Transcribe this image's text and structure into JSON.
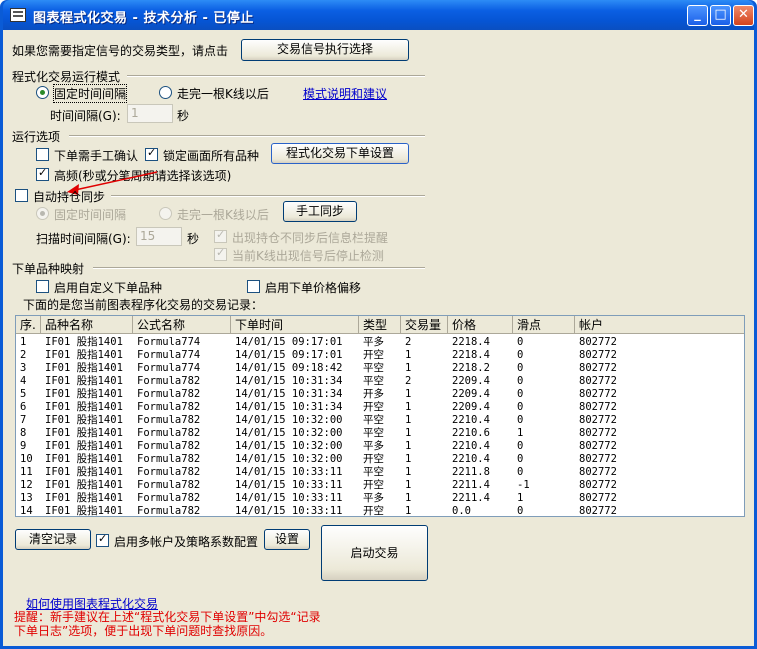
{
  "window": {
    "title": "图表程式化交易 - 技术分析 - 已停止",
    "min": "_",
    "max": "□",
    "close": "✕"
  },
  "signal": {
    "prompt": "如果您需要指定信号的交易类型，请点击",
    "button": "交易信号执行选择"
  },
  "mode": {
    "heading": "程式化交易运行模式",
    "fixed_interval": "固定时间间隔",
    "bar_close": "走完一根K线以后",
    "help_link": "模式说明和建议",
    "interval_label": "时间间隔(G):",
    "interval_value": "1",
    "interval_unit": "秒"
  },
  "run_options": {
    "heading": "运行选项",
    "manual_confirm": "下单需手工确认",
    "lock_symbols": "锁定画面所有品种",
    "order_settings_button": "程式化交易下单设置",
    "high_freq": "高频(秒或分笔周期请选择该选项)"
  },
  "sync": {
    "auto_sync": "自动持仓同步",
    "fixed_interval": "固定时间间隔",
    "bar_close": "走完一根K线以后",
    "manual_sync_button": "手工同步",
    "scan_label": "扫描时间间隔(G):",
    "scan_value": "15",
    "scan_unit": "秒",
    "notify_mismatch": "出现持仓不同步后信息栏提醒",
    "stop_on_signal": "当前K线出现信号后停止检测"
  },
  "mapping": {
    "heading": "下单品种映射",
    "custom_symbol": "启用自定义下单品种",
    "price_offset": "启用下单价格偏移",
    "records_caption": "下面的是您当前图表程序化交易的交易记录："
  },
  "table": {
    "headers": [
      "序.",
      "品种名称",
      "公式名称",
      "下单时间",
      "类型",
      "交易量",
      "价格",
      "滑点",
      "帐户"
    ],
    "rows": [
      [
        "1",
        "IF01 股指1401",
        "Formula774",
        "14/01/15 09:17:01",
        "平多",
        "2",
        "2218.4",
        "0",
        "802772"
      ],
      [
        "2",
        "IF01 股指1401",
        "Formula774",
        "14/01/15 09:17:01",
        "开空",
        "1",
        "2218.4",
        "0",
        "802772"
      ],
      [
        "3",
        "IF01 股指1401",
        "Formula774",
        "14/01/15 09:18:42",
        "平空",
        "1",
        "2218.2",
        "0",
        "802772"
      ],
      [
        "4",
        "IF01 股指1401",
        "Formula782",
        "14/01/15 10:31:34",
        "平空",
        "2",
        "2209.4",
        "0",
        "802772"
      ],
      [
        "5",
        "IF01 股指1401",
        "Formula782",
        "14/01/15 10:31:34",
        "开多",
        "1",
        "2209.4",
        "0",
        "802772"
      ],
      [
        "6",
        "IF01 股指1401",
        "Formula782",
        "14/01/15 10:31:34",
        "开空",
        "1",
        "2209.4",
        "0",
        "802772"
      ],
      [
        "7",
        "IF01 股指1401",
        "Formula782",
        "14/01/15 10:32:00",
        "平空",
        "1",
        "2210.4",
        "0",
        "802772"
      ],
      [
        "8",
        "IF01 股指1401",
        "Formula782",
        "14/01/15 10:32:00",
        "平空",
        "1",
        "2210.6",
        "1",
        "802772"
      ],
      [
        "9",
        "IF01 股指1401",
        "Formula782",
        "14/01/15 10:32:00",
        "平多",
        "1",
        "2210.4",
        "0",
        "802772"
      ],
      [
        "10",
        "IF01 股指1401",
        "Formula782",
        "14/01/15 10:32:00",
        "开空",
        "1",
        "2210.4",
        "0",
        "802772"
      ],
      [
        "11",
        "IF01 股指1401",
        "Formula782",
        "14/01/15 10:33:11",
        "平空",
        "1",
        "2211.8",
        "0",
        "802772"
      ],
      [
        "12",
        "IF01 股指1401",
        "Formula782",
        "14/01/15 10:33:11",
        "开空",
        "1",
        "2211.4",
        "-1",
        "802772"
      ],
      [
        "13",
        "IF01 股指1401",
        "Formula782",
        "14/01/15 10:33:11",
        "平多",
        "1",
        "2211.4",
        "1",
        "802772"
      ],
      [
        "14",
        "IF01 股指1401",
        "Formula782",
        "14/01/15 10:33:11",
        "开空",
        "1",
        "0.0",
        "0",
        "802772"
      ]
    ]
  },
  "footer": {
    "clear_button": "清空记录",
    "multi_account": "启用多帐户及策略系数配置",
    "settings_button": "设置",
    "start_button": "启动交易",
    "howto_link": "如何使用图表程式化交易",
    "hint_line1": "提醒：新手建议在上述“程式化交易下单设置”中勾选“记录",
    "hint_line2": "下单日志”选项，便于出现下单问题时查找原因。"
  }
}
